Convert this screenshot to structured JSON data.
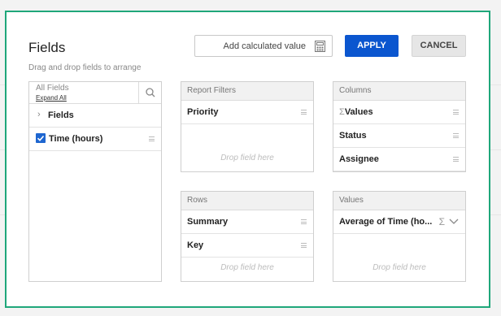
{
  "dialog": {
    "title": "Fields",
    "subtitle": "Drag and drop fields to arrange",
    "calc_label": "Add calculated value",
    "apply_label": "APPLY",
    "cancel_label": "CANCEL"
  },
  "all_fields": {
    "title": "All Fields",
    "expand_all": "Expand All",
    "group_label": "Fields",
    "items": [
      {
        "label": "Time (hours)",
        "checked": true
      }
    ]
  },
  "report_filters": {
    "title": "Report Filters",
    "items": [
      "Priority"
    ],
    "drop_hint": "Drop field here"
  },
  "columns": {
    "title": "Columns",
    "items": [
      "Values",
      "Status",
      "Assignee"
    ]
  },
  "rows": {
    "title": "Rows",
    "items": [
      "Summary",
      "Key"
    ],
    "drop_hint": "Drop field here"
  },
  "values": {
    "title": "Values",
    "items": [
      "Average of Time (ho..."
    ],
    "drop_hint": "Drop field here"
  },
  "colors": {
    "accent": "#0b56cf",
    "frame": "#1fa77a",
    "checkbox": "#1e66d0"
  }
}
